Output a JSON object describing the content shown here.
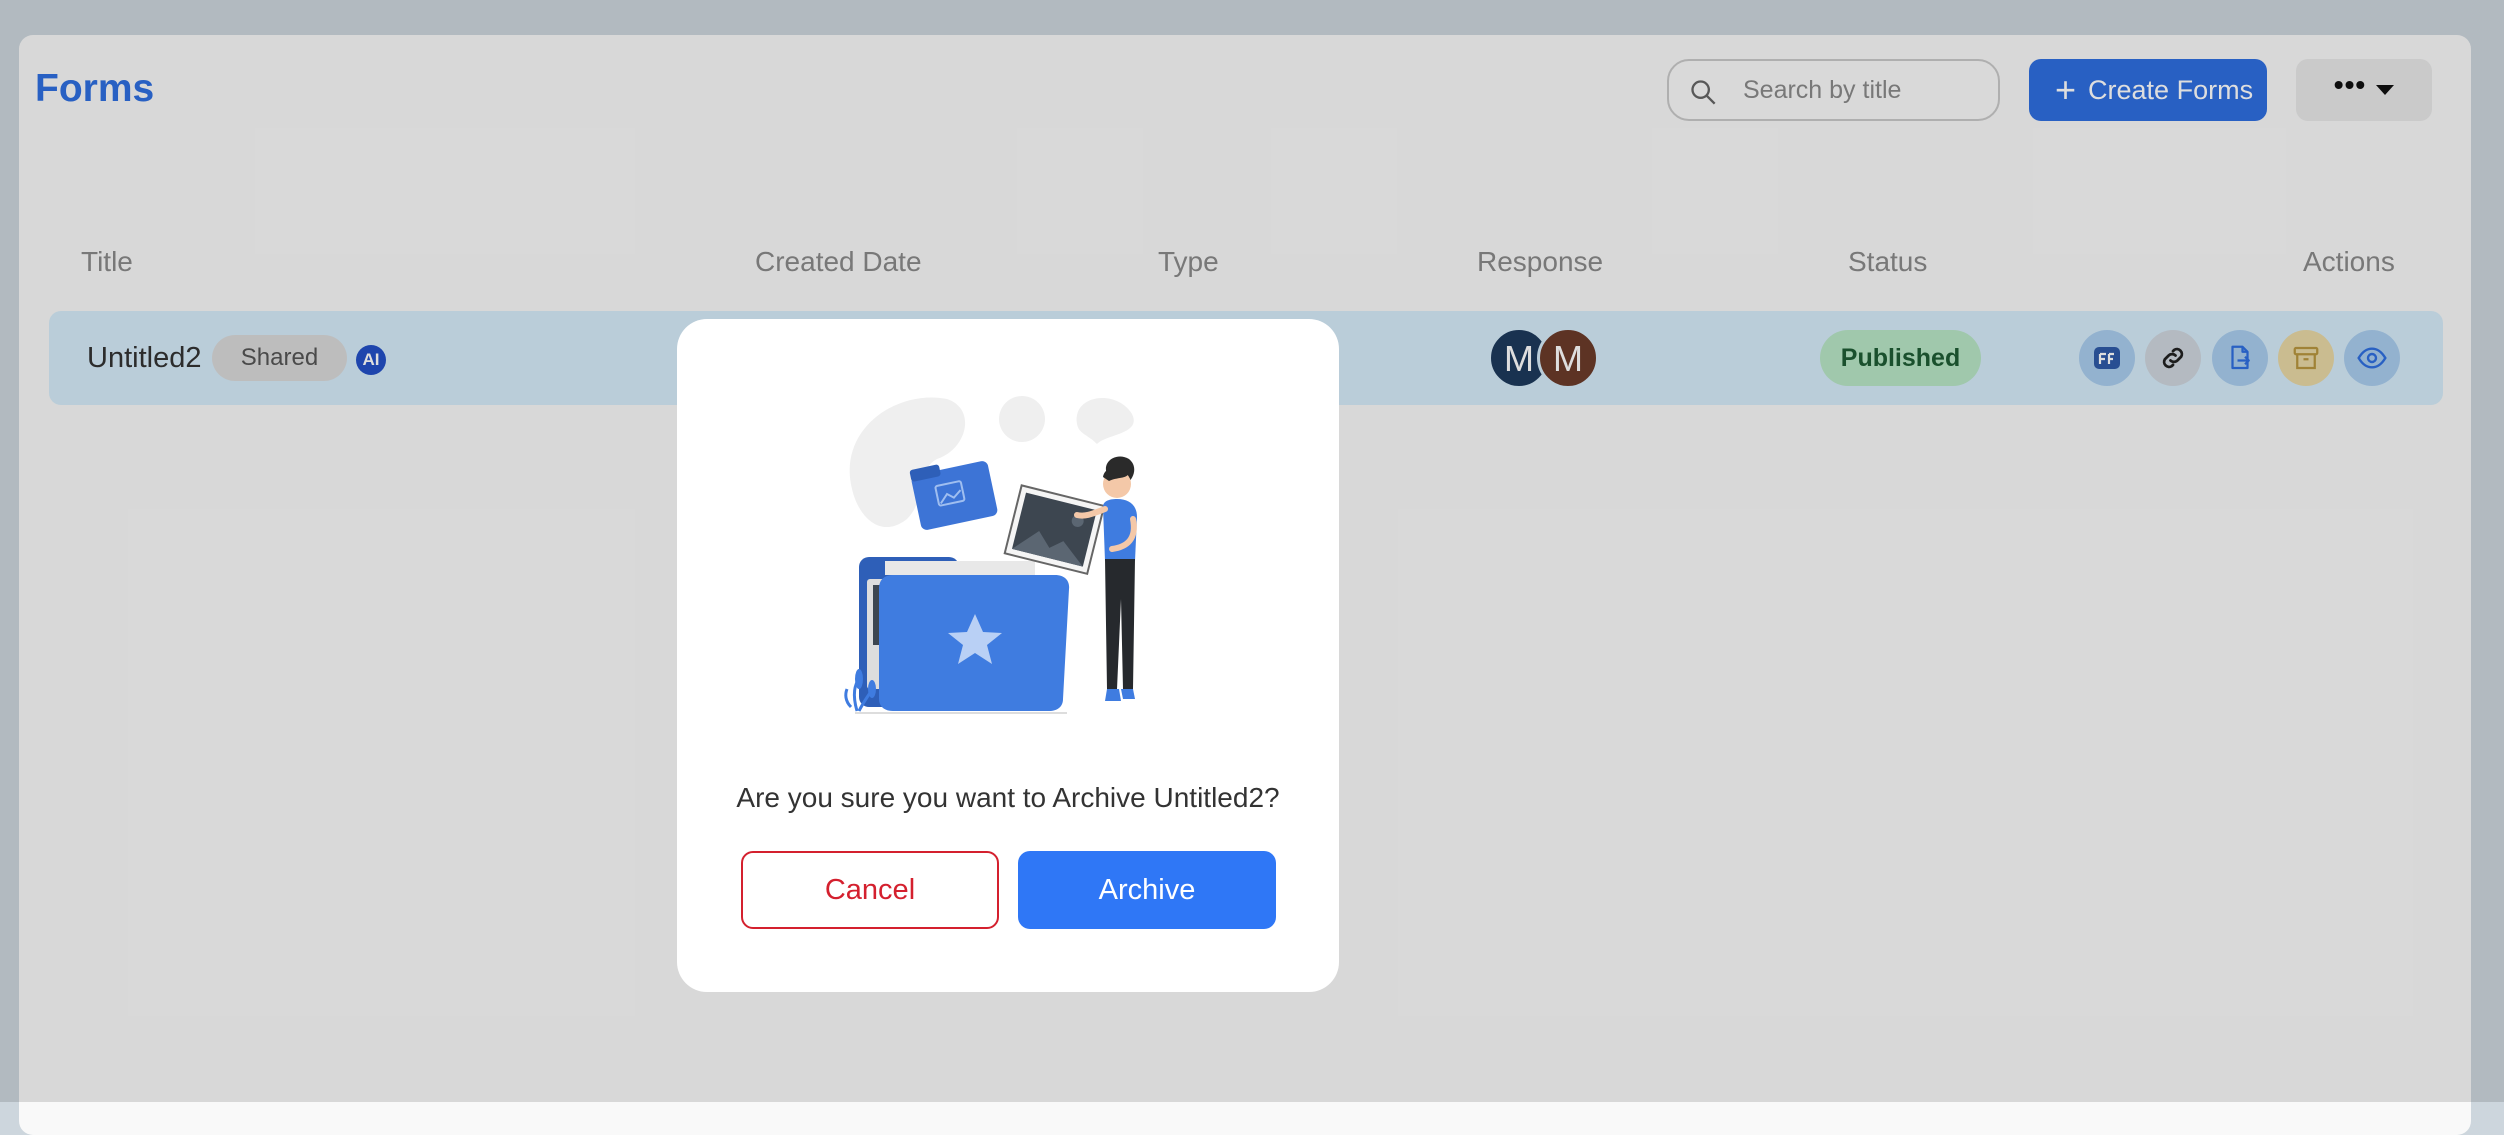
{
  "header": {
    "title": "Forms",
    "search_placeholder": "Search by title",
    "create_label": "Create Forms",
    "more_label": "•••"
  },
  "table": {
    "columns": [
      "Title",
      "Created Date",
      "Type",
      "Response",
      "Status",
      "Actions"
    ],
    "rows": [
      {
        "title": "Untitled2",
        "shared_badge": "Shared",
        "ai_badge": "AI",
        "responders": [
          "M",
          "M"
        ],
        "status": "Published"
      }
    ]
  },
  "modal": {
    "message": "Are you sure you want to Archive Untitled2?",
    "cancel_label": "Cancel",
    "archive_label": "Archive"
  },
  "icons": {
    "search": "search-icon",
    "plus": "plus-icon",
    "caret": "chevron-down-icon",
    "actions": [
      "forms-logo-icon",
      "link-icon",
      "export-file-icon",
      "archive-icon",
      "eye-icon"
    ]
  },
  "colors": {
    "accent": "#2f6fe0",
    "row_highlight": "#d6ecfa",
    "published": "#b8e6c6",
    "cancel": "#d4202e",
    "archive": "#2f77f6",
    "avatar_1": "#1d3a5c",
    "avatar_2": "#6b3b2a"
  }
}
